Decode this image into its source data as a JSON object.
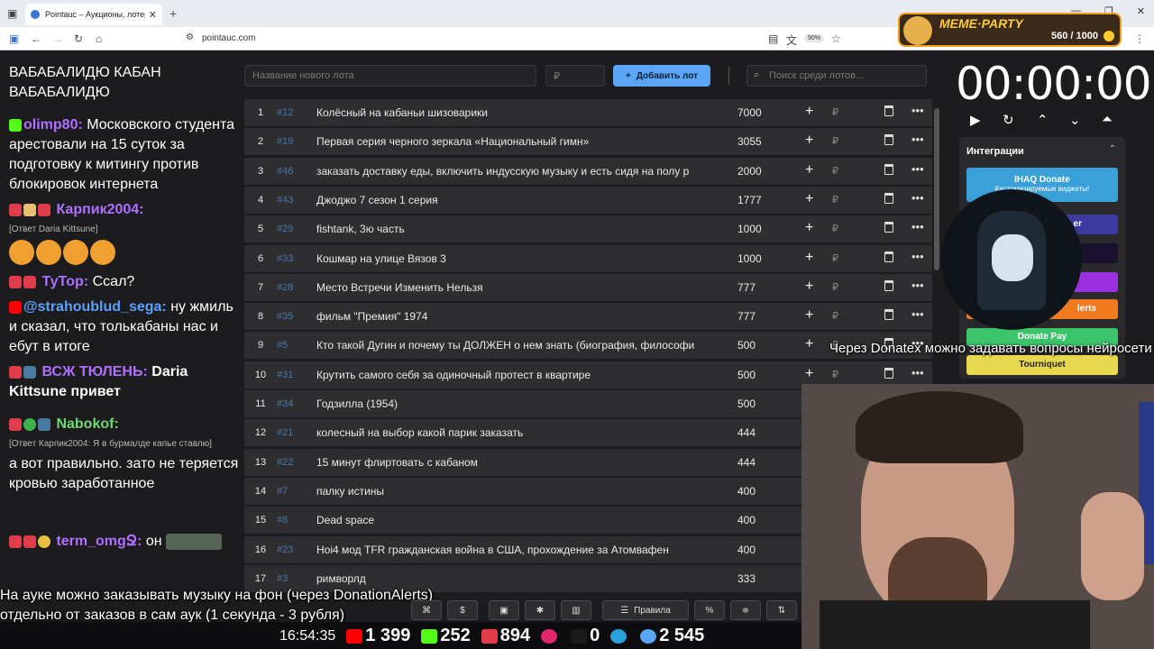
{
  "browser": {
    "tab_title": "Pointauc – Аукционы, лотереи",
    "url": "pointauc.com",
    "zoom": "90%"
  },
  "meme_party": {
    "title": "MEME·PARTY",
    "counter": "560 / 1000"
  },
  "chat": [
    {
      "user": "",
      "text": "ВАБАБАЛИДЮ КАБАН ВАБАБАЛИДЮ"
    },
    {
      "user": "olimp80:",
      "text": "Московского студента арестовали на 15 суток за подготовку к митингу против блокировок интернета"
    },
    {
      "user": "Карпик2004:",
      "reply": "[Ответ Daria Kittsune]",
      "text": ""
    },
    {
      "user": "ТуТор:",
      "text": "Ссал?"
    },
    {
      "user": "@strahoublud_sega:",
      "text": "ну жмиль и сказал, что толькабаны нас и ебут в итоге"
    },
    {
      "user": "ВСЖ ТЮЛЕНЬ:",
      "text": "Daria Kittsune привет"
    },
    {
      "user": "Nabokof:",
      "reply": "[Ответ Карпик2004: Я в бурмалде капье ставлю]",
      "text": "а вот правильно. зато не теряется кровью заработанное"
    },
    {
      "user": "term_omgՋ:",
      "text": "он"
    }
  ],
  "controls": {
    "new_lot_placeholder": "Название нового лота",
    "amount_placeholder": "₽",
    "add_button": "Добавить лот",
    "search_placeholder": "Поиск среди лотов..."
  },
  "lots": [
    {
      "n": "1",
      "id": "#12",
      "name": "Колёсный на кабаньи шизоварики",
      "amount": "7000"
    },
    {
      "n": "2",
      "id": "#19",
      "name": "Первая серия черного зеркала «Национальный гимн»",
      "amount": "3055"
    },
    {
      "n": "3",
      "id": "#46",
      "name": "заказать доставку еды, включить индусскую музыку и есть сидя на полу р",
      "amount": "2000"
    },
    {
      "n": "4",
      "id": "#43",
      "name": "Джоджо 7 сезон 1 серия",
      "amount": "1777"
    },
    {
      "n": "5",
      "id": "#29",
      "name": "fishtank, 3ю часть",
      "amount": "1000"
    },
    {
      "n": "6",
      "id": "#33",
      "name": "Кошмар на улице Вязов 3",
      "amount": "1000"
    },
    {
      "n": "7",
      "id": "#28",
      "name": "Место Встречи Изменить Нельзя",
      "amount": "777"
    },
    {
      "n": "8",
      "id": "#35",
      "name": "фильм \"Премия\" 1974",
      "amount": "777"
    },
    {
      "n": "9",
      "id": "#5",
      "name": "Кто такой Дугин и почему ты ДОЛЖЕН о нем знать (биография, философи",
      "amount": "500"
    },
    {
      "n": "10",
      "id": "#31",
      "name": "Крутить самого себя за одиночный протест в квартире",
      "amount": "500"
    },
    {
      "n": "11",
      "id": "#34",
      "name": "Годзилла (1954)",
      "amount": "500"
    },
    {
      "n": "12",
      "id": "#21",
      "name": "колесный на выбор какой парик заказать",
      "amount": "444"
    },
    {
      "n": "13",
      "id": "#22",
      "name": "15 минут флиртовать с кабаном",
      "amount": "444"
    },
    {
      "n": "14",
      "id": "#7",
      "name": "палку истины",
      "amount": "400"
    },
    {
      "n": "15",
      "id": "#8",
      "name": "Dead space",
      "amount": "400"
    },
    {
      "n": "16",
      "id": "#23",
      "name": "Hoi4 мод TFR гражданская война в США, прохождение за Атомвафен",
      "amount": "400"
    },
    {
      "n": "17",
      "id": "#3",
      "name": "римворлд",
      "amount": "333"
    }
  ],
  "lot_currency": "₽",
  "timer": {
    "value": "00:00:00"
  },
  "integrations": {
    "title": "Интеграции",
    "buttons": [
      {
        "label": "IHAQ Donate",
        "sub": "Кастомизируемые виджеты!",
        "color": "#3aa0d8"
      },
      {
        "label": "er",
        "color": "#3a3aa0"
      },
      {
        "label": "",
        "color": "#1a1030"
      },
      {
        "label": "",
        "color": "#9a30e0"
      },
      {
        "label": "lerts",
        "color": "#f07a20"
      },
      {
        "label": "Donate Pay",
        "color": "#3cc46a"
      },
      {
        "label": "Tourniquet",
        "color": "#e8d850"
      }
    ]
  },
  "overlays": {
    "donatex": "Через Donatex можно задавать вопросы нейросети",
    "music_line1": "На ауке можно заказывать музыку на фон (через DonationAlerts)",
    "music_line2": "отдельно от заказов в сам аук (1 секунда - 3 рубля)"
  },
  "toolbar": {
    "rules": "Правила"
  },
  "stream_stats": {
    "time": "16:54:35",
    "youtube": "1 399",
    "kick": "252",
    "vk": "894",
    "rutube": "0",
    "viewers": "2 545"
  }
}
